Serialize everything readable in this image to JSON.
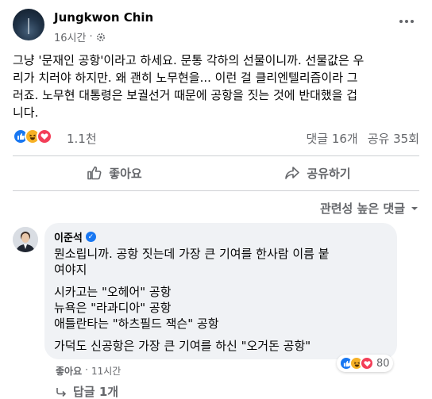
{
  "post": {
    "author": "Jungkwon Chin",
    "time": "16시간",
    "separator": "·",
    "privacy_icon": "gear-icon",
    "text": "그냥 '문재인 공항'이라고 하세요. 문통 각하의 선물이니까. 선물값은 우\n리가 치러야 하지만. 왜 괜히 노무현을... 이런 걸 클리엔텔리즘이라 그\n러죠. 노무현 대통령은 보궐선거 때문에 공항을 짓는 것에 반대했을 겁\n니다.",
    "reaction_count": "1.1천",
    "comments_count": "댓글 16개",
    "shares_count": "공유 35회"
  },
  "actions": {
    "like": "좋아요",
    "share": "공유하기"
  },
  "comments_sort": "관련성 높은 댓글",
  "comment": {
    "author": "이준석",
    "text1": "뭔소립니까. 공항 짓는데 가장 큰 기여를 한사람 이름 붙\n여야지",
    "text2": "시카고는 \"오헤어\" 공항\n뉴욕은 \"라과디아\" 공항\n애틀란타는 \"하츠필드 잭슨\" 공항",
    "text3": "가덕도 신공항은 가장 큰 기여를 하신 \"오거돈 공항\"",
    "like_label": "좋아요",
    "dot": "·",
    "time": "11시간",
    "reaction_count": "80",
    "replies_label": "답글 1개"
  },
  "colors": {
    "accent": "#1877f2",
    "secondary_text": "#65676b",
    "bubble": "#f0f2f5"
  }
}
